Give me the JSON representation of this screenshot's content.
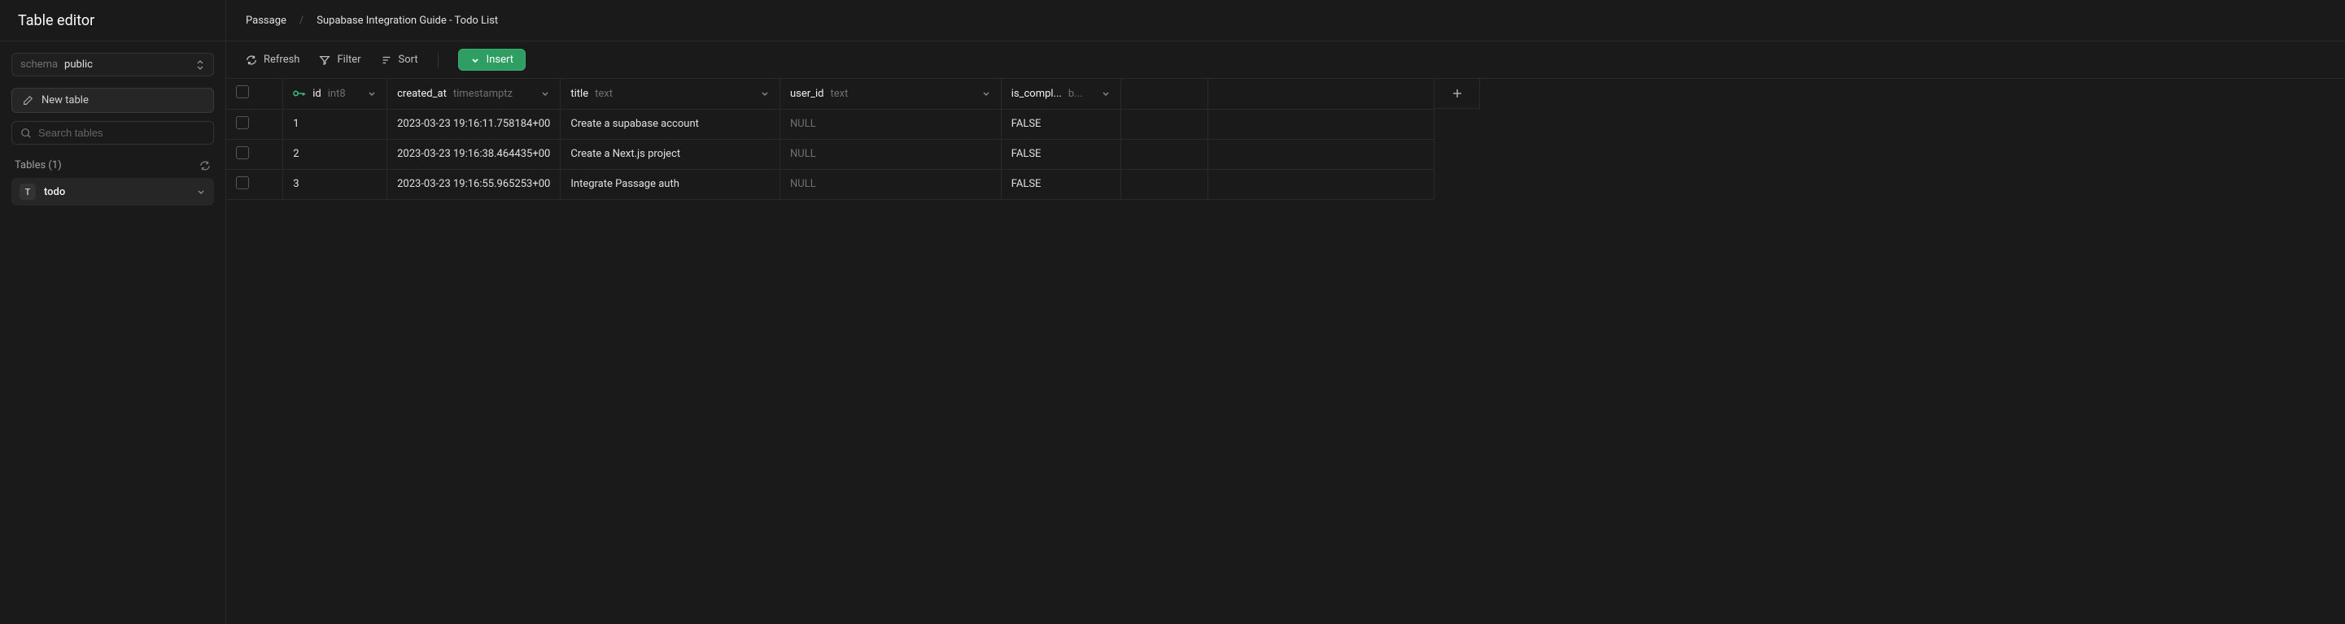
{
  "sidebar": {
    "title": "Table editor",
    "schema_label": "schema",
    "schema_value": "public",
    "new_table_label": "New table",
    "search_placeholder": "Search tables",
    "tables_heading": "Tables (1)",
    "tables": [
      {
        "avatar": "T",
        "name": "todo"
      }
    ]
  },
  "breadcrumb": {
    "items": [
      "Passage",
      "Supabase Integration Guide - Todo List"
    ]
  },
  "toolbar": {
    "refresh": "Refresh",
    "filter": "Filter",
    "sort": "Sort",
    "insert": "Insert"
  },
  "columns": [
    {
      "name": "id",
      "type": "int8",
      "pk": true
    },
    {
      "name": "created_at",
      "type": "timestamptz",
      "pk": false
    },
    {
      "name": "title",
      "type": "text",
      "pk": false
    },
    {
      "name": "user_id",
      "type": "text",
      "pk": false
    },
    {
      "name": "is_compl...",
      "type": "b...",
      "pk": false
    }
  ],
  "rows": [
    {
      "id": "1",
      "created_at": "2023-03-23 19:16:11.758184+00",
      "title": "Create a supabase account",
      "user_id": "NULL",
      "is_complete": "FALSE"
    },
    {
      "id": "2",
      "created_at": "2023-03-23 19:16:38.464435+00",
      "title": "Create a Next.js project",
      "user_id": "NULL",
      "is_complete": "FALSE"
    },
    {
      "id": "3",
      "created_at": "2023-03-23 19:16:55.965253+00",
      "title": "Integrate Passage auth",
      "user_id": "NULL",
      "is_complete": "FALSE"
    }
  ]
}
